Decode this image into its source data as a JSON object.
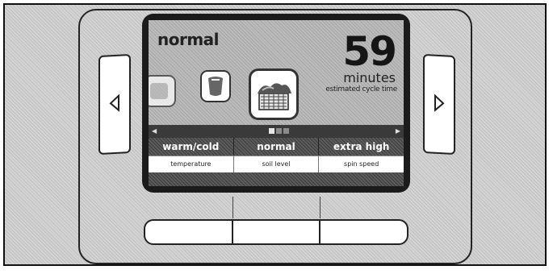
{
  "cycle": {
    "name": "normal",
    "time_value": "59",
    "time_unit": "minutes",
    "time_caption": "estimated cycle time"
  },
  "icons": {
    "prev": "triangle-left",
    "next": "triangle-right",
    "selected_cycle": "laundry-basket",
    "other_cycle_1": "cycle-icon",
    "other_cycle_2": "cycle-icon"
  },
  "pagination": {
    "total": 3,
    "active": 1
  },
  "settings": [
    {
      "value": "warm/cold",
      "label": "temperature"
    },
    {
      "value": "normal",
      "label": "soil level"
    },
    {
      "value": "extra high",
      "label": "spin speed"
    }
  ],
  "colors": {
    "screen_bezel": "#1b1b1b",
    "settings_bar": "#5c5c5c",
    "label_row": "#ffffff"
  }
}
